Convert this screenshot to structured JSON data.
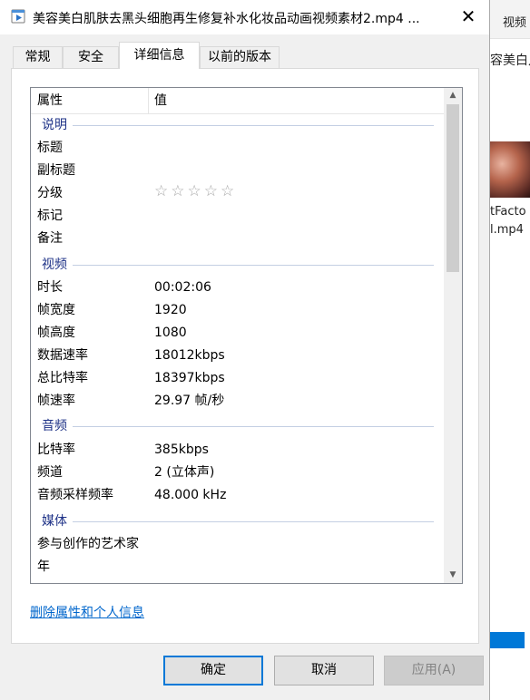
{
  "background": {
    "topbar_label": "视频",
    "breadcrumb": "容美白凡",
    "thumb_caption_1": "tFacto",
    "thumb_caption_2": "l.mp4"
  },
  "titlebar": {
    "title": "美容美白肌肤去黑头细胞再生修复补水化妆品动画视频素材2.mp4 ...",
    "close_glyph": "✕"
  },
  "tabs": [
    {
      "label": "常规"
    },
    {
      "label": "安全"
    },
    {
      "label": "详细信息"
    },
    {
      "label": "以前的版本"
    }
  ],
  "active_tab": "详细信息",
  "table": {
    "col_property": "属性",
    "col_value": "值",
    "groups": {
      "description": "说明",
      "video": "视频",
      "audio": "音频",
      "media": "媒体"
    },
    "rows": {
      "title": {
        "label": "标题",
        "value": ""
      },
      "subtitle": {
        "label": "副标题",
        "value": ""
      },
      "rating": {
        "label": "分级",
        "value": "☆☆☆☆☆"
      },
      "tags": {
        "label": "标记",
        "value": ""
      },
      "comments": {
        "label": "备注",
        "value": ""
      },
      "length": {
        "label": "时长",
        "value": "00:02:06"
      },
      "frame_width": {
        "label": "帧宽度",
        "value": "1920"
      },
      "frame_height": {
        "label": "帧高度",
        "value": "1080"
      },
      "data_rate": {
        "label": "数据速率",
        "value": "18012kbps"
      },
      "total_bitrate": {
        "label": "总比特率",
        "value": "18397kbps"
      },
      "frame_rate": {
        "label": "帧速率",
        "value": "29.97 帧/秒"
      },
      "audio_bitrate": {
        "label": "比特率",
        "value": "385kbps"
      },
      "channels": {
        "label": "频道",
        "value": "2 (立体声)"
      },
      "sample_rate": {
        "label": "音频采样频率",
        "value": "48.000 kHz"
      },
      "contributing_artists": {
        "label": "参与创作的艺术家",
        "value": ""
      },
      "year": {
        "label": "年",
        "value": ""
      }
    }
  },
  "remove_properties_link": "删除属性和个人信息",
  "buttons": {
    "ok": "确定",
    "cancel": "取消",
    "apply": "应用(A)"
  }
}
